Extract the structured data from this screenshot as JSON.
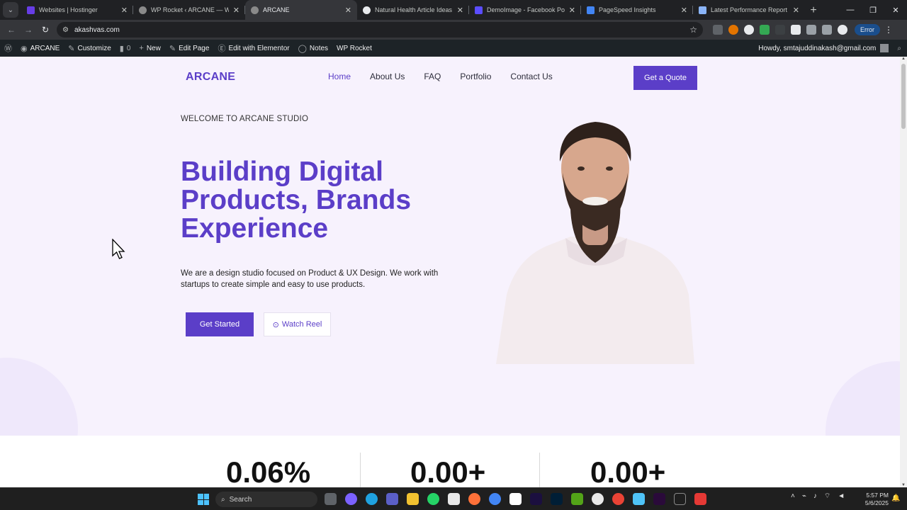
{
  "browser": {
    "tabs": [
      {
        "title": "Websites | Hostinger",
        "color": "#673de6",
        "active": false
      },
      {
        "title": "WP Rocket ‹ ARCANE — WordP",
        "color": "#8a8a8a",
        "active": false
      },
      {
        "title": "ARCANE",
        "color": "#8a8a8a",
        "active": true
      },
      {
        "title": "Natural Health Article Ideas",
        "color": "#e8eaed",
        "active": false
      },
      {
        "title": "DemoImage - Facebook Post (",
        "color": "#5b4dff",
        "active": false
      },
      {
        "title": "PageSpeed Insights",
        "color": "#4285f4",
        "active": false
      },
      {
        "title": "Latest Performance Report for",
        "color": "#8ab4f8",
        "active": false
      }
    ],
    "url": "akashvas.com",
    "error_chip": "Error"
  },
  "wp_admin": {
    "site_name": "ARCANE",
    "customize": "Customize",
    "comments_count": "0",
    "new": "New",
    "edit_page": "Edit Page",
    "edit_elementor": "Edit with Elementor",
    "notes": "Notes",
    "wp_rocket": "WP Rocket",
    "howdy": "Howdy, smtajuddinakash@gmail.com"
  },
  "site": {
    "logo": "ARCANE",
    "nav": [
      "Home",
      "About Us",
      "FAQ",
      "Portfolio",
      "Contact Us"
    ],
    "quote_button": "Get a Quote",
    "eyebrow": "WELCOME TO ARCANE STUDIO",
    "headline": "Building Digital Products, Brands Experience",
    "lead": "We are a design studio focused on Product & UX Design. We work with startups to create simple and easy to use products.",
    "cta_primary": "Get Started",
    "cta_secondary": "Watch Reel",
    "stats": [
      "0.06%",
      "0.00+",
      "0.00+"
    ],
    "accent_color": "#5b3ec8"
  },
  "taskbar": {
    "search_placeholder": "Search",
    "time": "5:57 PM",
    "date": "5/6/2025"
  }
}
